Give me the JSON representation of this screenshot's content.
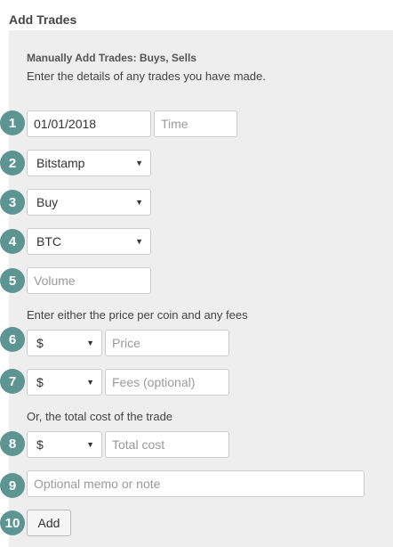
{
  "header": {
    "title": "Add Trades"
  },
  "form": {
    "subtitle": "Manually Add Trades: Buys, Sells",
    "intro": "Enter the details of any trades you have made.",
    "steps": [
      "1",
      "2",
      "3",
      "4",
      "5",
      "6",
      "7",
      "8",
      "9",
      "10"
    ],
    "date_value": "01/01/2018",
    "time_placeholder": "Time",
    "exchange_selected": "Bitstamp",
    "side_selected": "Buy",
    "coin_selected": "BTC",
    "volume_placeholder": "Volume",
    "price_hint": "Enter either the price per coin and any fees",
    "price_currency": "$",
    "price_placeholder": "Price",
    "fees_currency": "$",
    "fees_placeholder": "Fees (optional)",
    "total_hint": "Or, the total cost of the trade",
    "total_currency": "$",
    "total_placeholder": "Total cost",
    "memo_placeholder": "Optional memo or note",
    "add_label": "Add"
  },
  "icons": {
    "dropdown": "chevron-down-icon"
  },
  "colors": {
    "step_badge": "#5c9591",
    "panel_bg": "#eeeeee"
  }
}
